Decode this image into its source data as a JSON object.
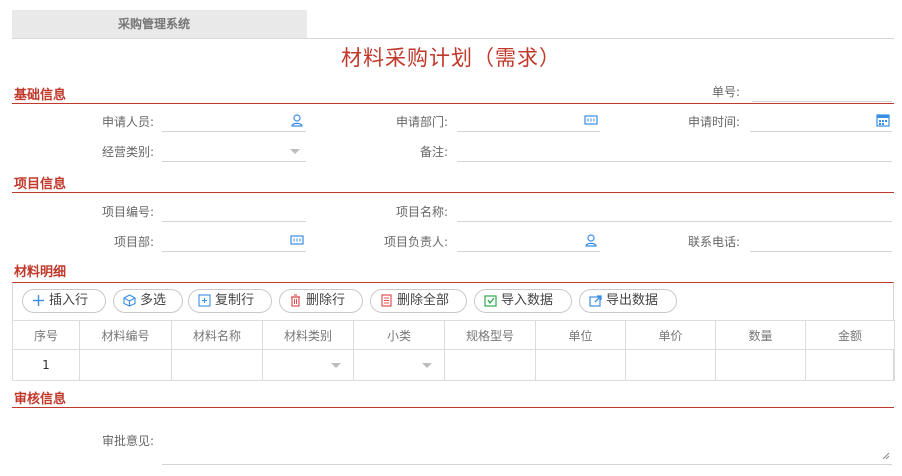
{
  "app": {
    "tab_title": "采购管理系统"
  },
  "document": {
    "title": "材料采购计划（需求）"
  },
  "sections": {
    "basic": "基础信息",
    "project": "项目信息",
    "materials": "材料明细",
    "review": "审核信息"
  },
  "basic": {
    "order_no_label": "单号:",
    "applicant_label": "申请人员:",
    "department_label": "申请部门:",
    "apply_time_label": "申请时间:",
    "business_type_label": "经营类别:",
    "remark_label": "备注:"
  },
  "project": {
    "project_no_label": "项目编号:",
    "project_name_label": "项目名称:",
    "project_dept_label": "项目部:",
    "project_lead_label": "项目负责人:",
    "contact_phone_label": "联系电话:"
  },
  "toolbar": {
    "insert_row": "插入行",
    "multi_select": "多选",
    "copy_row": "复制行",
    "delete_row": "删除行",
    "delete_all": "删除全部",
    "import_data": "导入数据",
    "export_data": "导出数据"
  },
  "grid": {
    "columns": [
      "序号",
      "材料编号",
      "材料名称",
      "材料类别",
      "小类",
      "规格型号",
      "单位",
      "单价",
      "数量",
      "金额"
    ],
    "rows": [
      {
        "index": "1"
      }
    ]
  },
  "review": {
    "opinion_label": "审批意见:"
  },
  "colors": {
    "accent": "#c0392b",
    "icon_blue": "#3a8ee6",
    "icon_red": "#e05050",
    "icon_green": "#2fa84f"
  }
}
